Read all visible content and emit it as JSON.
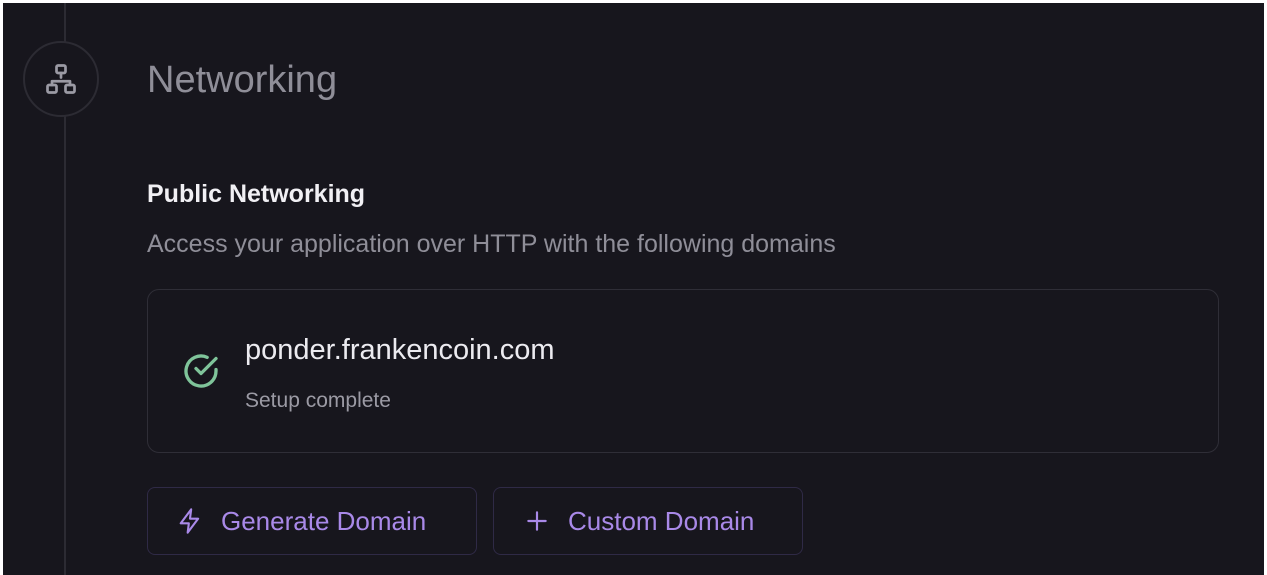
{
  "section": {
    "title": "Networking",
    "icon": "network-icon"
  },
  "public_networking": {
    "title": "Public Networking",
    "description": "Access your application over HTTP with the following domains"
  },
  "domains": [
    {
      "name": "ponder.frankencoin.com",
      "status": "Setup complete",
      "icon": "check-circle-icon"
    }
  ],
  "actions": {
    "generate_label": "Generate Domain",
    "generate_icon": "lightning-icon",
    "custom_label": "Custom Domain",
    "custom_icon": "plus-icon"
  },
  "colors": {
    "background": "#17161d",
    "accent": "#a989e8",
    "success": "#7fc49a",
    "muted_text": "#8f8e98"
  }
}
